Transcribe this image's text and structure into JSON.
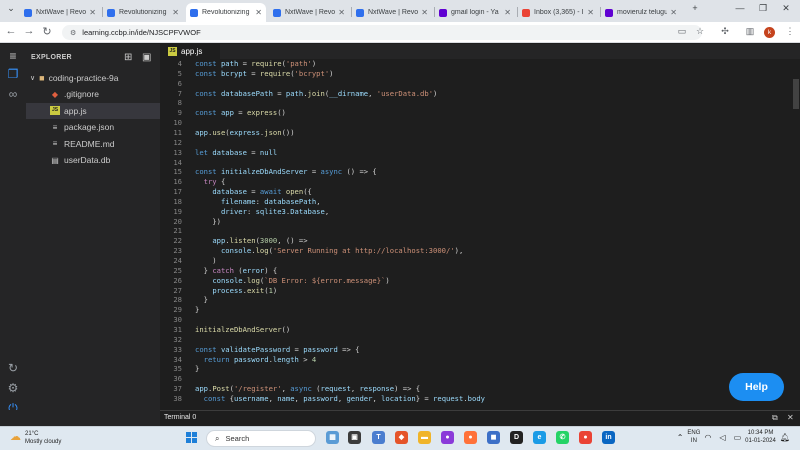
{
  "browser": {
    "tabs": [
      {
        "title": "NxtWave | Revolu",
        "active": false,
        "favicon_color": "#2f6fed"
      },
      {
        "title": "Revolutionizing",
        "active": false,
        "favicon_color": "#2f6fed"
      },
      {
        "title": "Revolutionizing",
        "active": true,
        "favicon_color": "#2f6fed"
      },
      {
        "title": "NxtWave | Revol",
        "active": false,
        "favicon_color": "#2f6fed"
      },
      {
        "title": "NxtWave | Revol",
        "active": false,
        "favicon_color": "#2f6fed"
      },
      {
        "title": "gmail login - Ya",
        "active": false,
        "favicon_color": "#6001d2"
      },
      {
        "title": "Inbox (3,365) - I",
        "active": false,
        "favicon_color": "#ea4335"
      },
      {
        "title": "movierulz telugu",
        "active": false,
        "favicon_color": "#6001d2"
      }
    ],
    "new_tab": "+",
    "url": "learning.ccbp.in/ide/NJSCPFVWOF",
    "profile_initial": "k"
  },
  "ide": {
    "explorer_title": "EXPLORER",
    "folder": "coding-practice-9a",
    "files": [
      {
        "name": ".gitignore",
        "icon": "git-icon",
        "glyph": "◆",
        "color": "#e05f3f",
        "selected": false
      },
      {
        "name": "app.js",
        "icon": "js-file-icon",
        "glyph": "JS",
        "color": "#cbcb41",
        "selected": true
      },
      {
        "name": "package.json",
        "icon": "json-file-icon",
        "glyph": "≡",
        "color": "#cccccc",
        "selected": false
      },
      {
        "name": "README.md",
        "icon": "markdown-file-icon",
        "glyph": "≡",
        "color": "#cccccc",
        "selected": false
      },
      {
        "name": "userData.db",
        "icon": "database-file-icon",
        "glyph": "▤",
        "color": "#cccccc",
        "selected": false
      }
    ],
    "editor_tab": "app.js",
    "code_lines": [
      {
        "n": "4",
        "text": "const path = require('path')"
      },
      {
        "n": "5",
        "text": "const bcrypt = require('bcrypt')"
      },
      {
        "n": "6",
        "text": ""
      },
      {
        "n": "7",
        "text": "const databasePath = path.join(__dirname, 'userData.db')"
      },
      {
        "n": "8",
        "text": ""
      },
      {
        "n": "9",
        "text": "const app = express()"
      },
      {
        "n": "10",
        "text": ""
      },
      {
        "n": "11",
        "text": "app.use(express.json())"
      },
      {
        "n": "12",
        "text": ""
      },
      {
        "n": "13",
        "text": "let database = null"
      },
      {
        "n": "14",
        "text": ""
      },
      {
        "n": "15",
        "text": "const initialzeDbAndServer = async () => {"
      },
      {
        "n": "16",
        "text": "  try {"
      },
      {
        "n": "17",
        "text": "    database = await open({"
      },
      {
        "n": "18",
        "text": "      filename: databasePath,"
      },
      {
        "n": "19",
        "text": "      driver: sqlite3.Database,"
      },
      {
        "n": "20",
        "text": "    })"
      },
      {
        "n": "21",
        "text": ""
      },
      {
        "n": "22",
        "text": "    app.listen(3000, () =>"
      },
      {
        "n": "23",
        "text": "      console.log('Server Running at http://localhost:3000/'),"
      },
      {
        "n": "24",
        "text": "    )"
      },
      {
        "n": "25",
        "text": "  } catch (error) {"
      },
      {
        "n": "26",
        "text": "    console.log(`DB Error: ${error.message}`)"
      },
      {
        "n": "27",
        "text": "    process.exit(1)"
      },
      {
        "n": "28",
        "text": "  }"
      },
      {
        "n": "29",
        "text": "}"
      },
      {
        "n": "30",
        "text": ""
      },
      {
        "n": "31",
        "text": "initialzeDbAndServer()"
      },
      {
        "n": "32",
        "text": ""
      },
      {
        "n": "33",
        "text": "const validatePassword = password => {"
      },
      {
        "n": "34",
        "text": "  return password.length > 4"
      },
      {
        "n": "35",
        "text": "}"
      },
      {
        "n": "36",
        "text": ""
      },
      {
        "n": "37",
        "text": "app.Post('/register', async (request, response) => {"
      },
      {
        "n": "38",
        "text": "  const {username, name, password, gender, location} = request.body"
      }
    ],
    "help_button": "Help",
    "terminal_label": "Terminal",
    "terminal_count": "0"
  },
  "taskbar": {
    "weather_temp": "21°C",
    "weather_desc": "Mostly cloudy",
    "search_placeholder": "Search",
    "language": "ENG",
    "region": "IN",
    "time": "10:34 PM",
    "date": "01-01-2024"
  }
}
